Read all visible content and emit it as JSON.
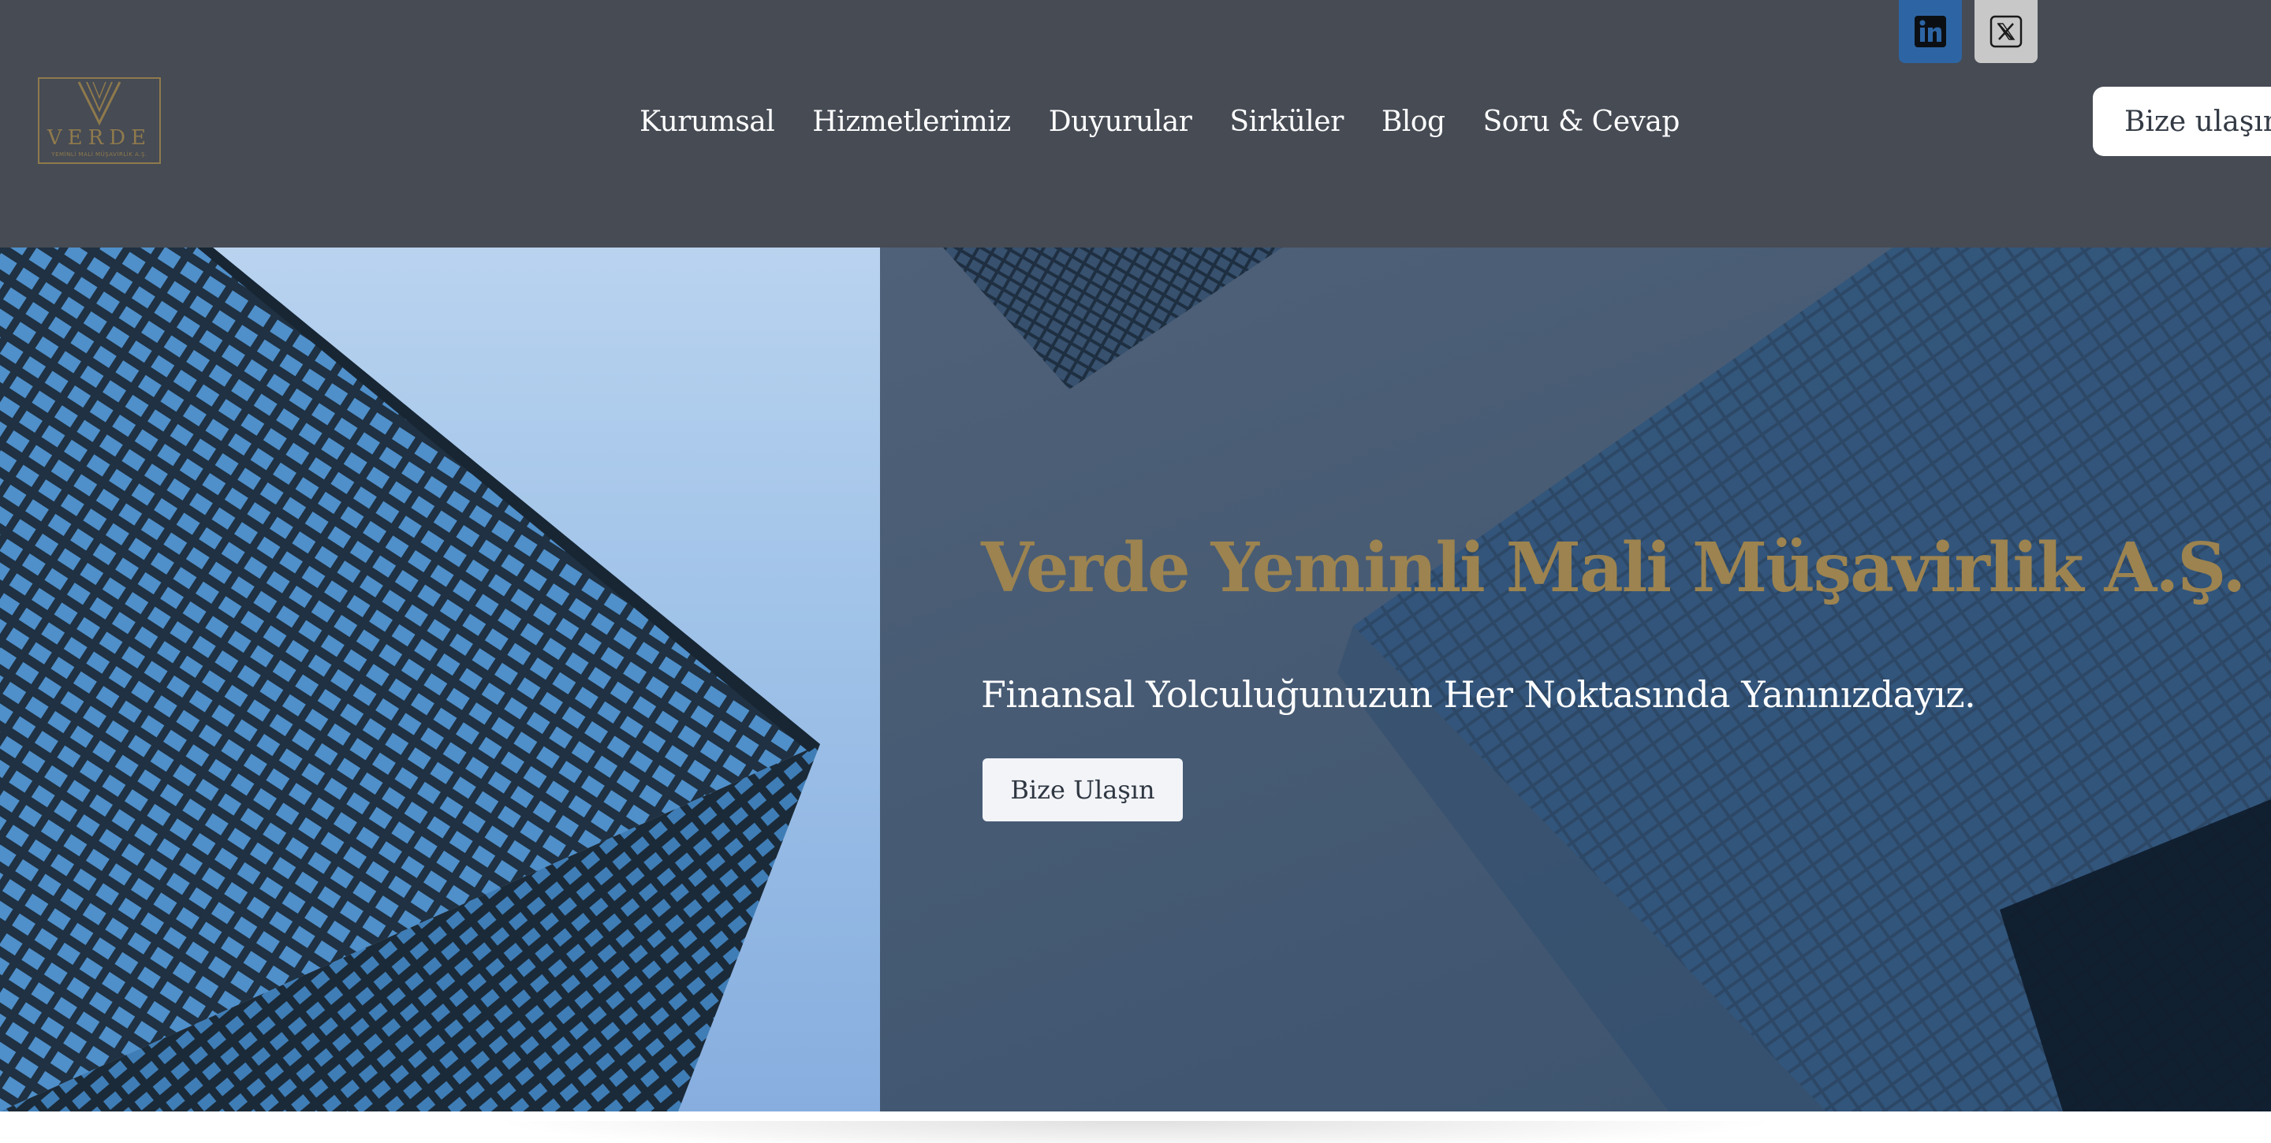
{
  "brand": {
    "logo_word": "VERDE",
    "logo_sub": "YEMİNLİ MALİ MÜŞAVİRLİK A.Ş.",
    "gold": "#8f7a4c"
  },
  "nav": {
    "items": [
      {
        "label": "Kurumsal"
      },
      {
        "label": "Hizmetlerimiz"
      },
      {
        "label": "Duyurular"
      },
      {
        "label": "Sirküler"
      },
      {
        "label": "Blog"
      },
      {
        "label": "Soru & Cevap"
      }
    ]
  },
  "social": {
    "linkedin_icon": "linkedin-icon",
    "twitter_icon": "x-twitter-icon",
    "linkedin_color": "#2d65a4",
    "twitter_color": "#c8c8c8"
  },
  "header": {
    "contact_label": "Bize ulaşın",
    "background": "#464b54"
  },
  "hero": {
    "title": "Verde Yeminli Mali Müşavirlik A.Ş.",
    "subtitle": "Finansal Yolculuğunuzun Her Noktasında Yanınızdayız.",
    "cta_label": "Bize Ulaşın",
    "title_color": "#9c834f"
  }
}
